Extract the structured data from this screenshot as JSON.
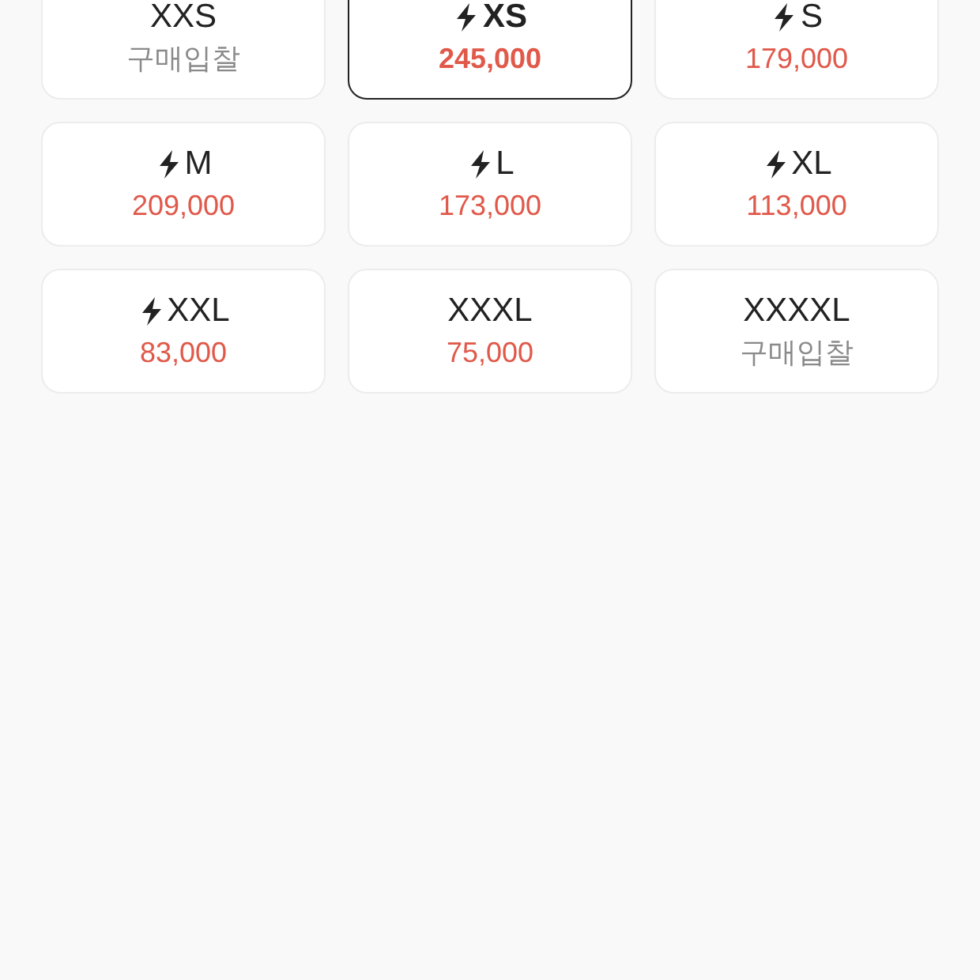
{
  "sizes": [
    {
      "size": "XXS",
      "fast": false,
      "kind": "bid",
      "price": "구매입찰",
      "selected": false
    },
    {
      "size": "XS",
      "fast": true,
      "kind": "price",
      "price": "245,000",
      "selected": true
    },
    {
      "size": "S",
      "fast": true,
      "kind": "price",
      "price": "179,000",
      "selected": false
    },
    {
      "size": "M",
      "fast": true,
      "kind": "price",
      "price": "209,000",
      "selected": false
    },
    {
      "size": "L",
      "fast": true,
      "kind": "price",
      "price": "173,000",
      "selected": false
    },
    {
      "size": "XL",
      "fast": true,
      "kind": "price",
      "price": "113,000",
      "selected": false
    },
    {
      "size": "XXL",
      "fast": true,
      "kind": "price",
      "price": "83,000",
      "selected": false
    },
    {
      "size": "XXXL",
      "fast": false,
      "kind": "price",
      "price": "75,000",
      "selected": false
    },
    {
      "size": "XXXXL",
      "fast": false,
      "kind": "bid",
      "price": "구매입찰",
      "selected": false
    }
  ]
}
